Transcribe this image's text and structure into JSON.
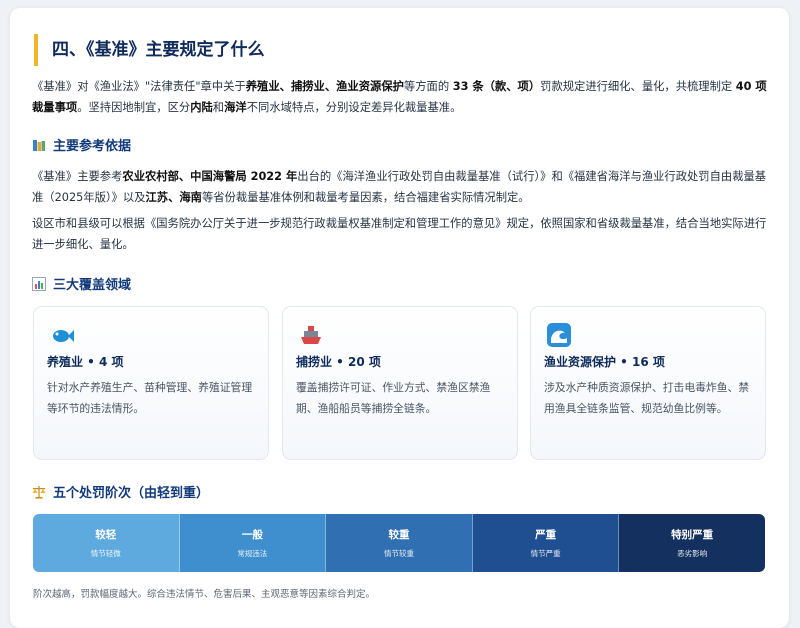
{
  "title": "四、《基准》主要规定了什么",
  "intro": {
    "p1": "《基准》对《渔业法》\"法律责任\"章中关于",
    "b1": "养殖业、捕捞业、渔业资源保护",
    "p2": "等方面的 ",
    "b2": "33 条（款、项）",
    "p3": "罚款规定进行细化、量化，共梳理制定 ",
    "b3": "40 项裁量事项",
    "p4": "。坚持因地制宜，区分",
    "b4": "内陆",
    "p5": "和",
    "b5": "海洋",
    "p6": "不同水域特点，分别设定差异化裁量基准。"
  },
  "basis": {
    "heading": "主要参考依据",
    "icon": "books-icon",
    "p1": {
      "t1": "《基准》主要参考",
      "b1": "农业农村部、中国海警局 2022 年",
      "t2": "出台的《海洋渔业行政处罚自由裁量基准（试行）》和《福建省海洋与渔业行政处罚自由裁量基准（2025年版）》以及",
      "b2": "江苏、海南",
      "t3": "等省份裁量基准体例和裁量考量因素，结合福建省实际情况制定。"
    },
    "p2": "设区市和县级可以根据《国务院办公厅关于进一步规范行政裁量权基准制定和管理工作的意见》规定，依照国家和省级裁量基准，结合当地实际进行进一步细化、量化。"
  },
  "coverage": {
    "heading": "三大覆盖领域",
    "icon": "bar-chart-icon",
    "cards": [
      {
        "icon": "fish-icon",
        "title": "养殖业 • 4 项",
        "desc": "针对水产养殖生产、苗种管理、养殖证管理等环节的违法情形。"
      },
      {
        "icon": "ship-icon",
        "title": "捕捞业 • 20 项",
        "desc": "覆盖捕捞许可证、作业方式、禁渔区禁渔期、渔船船员等捕捞全链条。"
      },
      {
        "icon": "wave-icon",
        "title": "渔业资源保护 • 16 项",
        "desc": "涉及水产种质资源保护、打击电毒炸鱼、禁用渔具全链条监管、规范幼鱼比例等。"
      }
    ]
  },
  "levels": {
    "heading": "五个处罚阶次（由轻到重）",
    "icon": "scales-icon",
    "items": [
      {
        "label": "较轻",
        "sub": "情节轻微",
        "color": "#5ea9dd"
      },
      {
        "label": "一般",
        "sub": "常规违法",
        "color": "#3f8fcf"
      },
      {
        "label": "较重",
        "sub": "情节较重",
        "color": "#2f6fb2"
      },
      {
        "label": "严重",
        "sub": "情节严重",
        "color": "#1f4f91"
      },
      {
        "label": "特别严重",
        "sub": "恶劣影响",
        "color": "#14305f"
      }
    ]
  },
  "footer": "阶次越高，罚款幅度越大。综合违法情节、危害后果、主观恶意等因素综合判定。"
}
